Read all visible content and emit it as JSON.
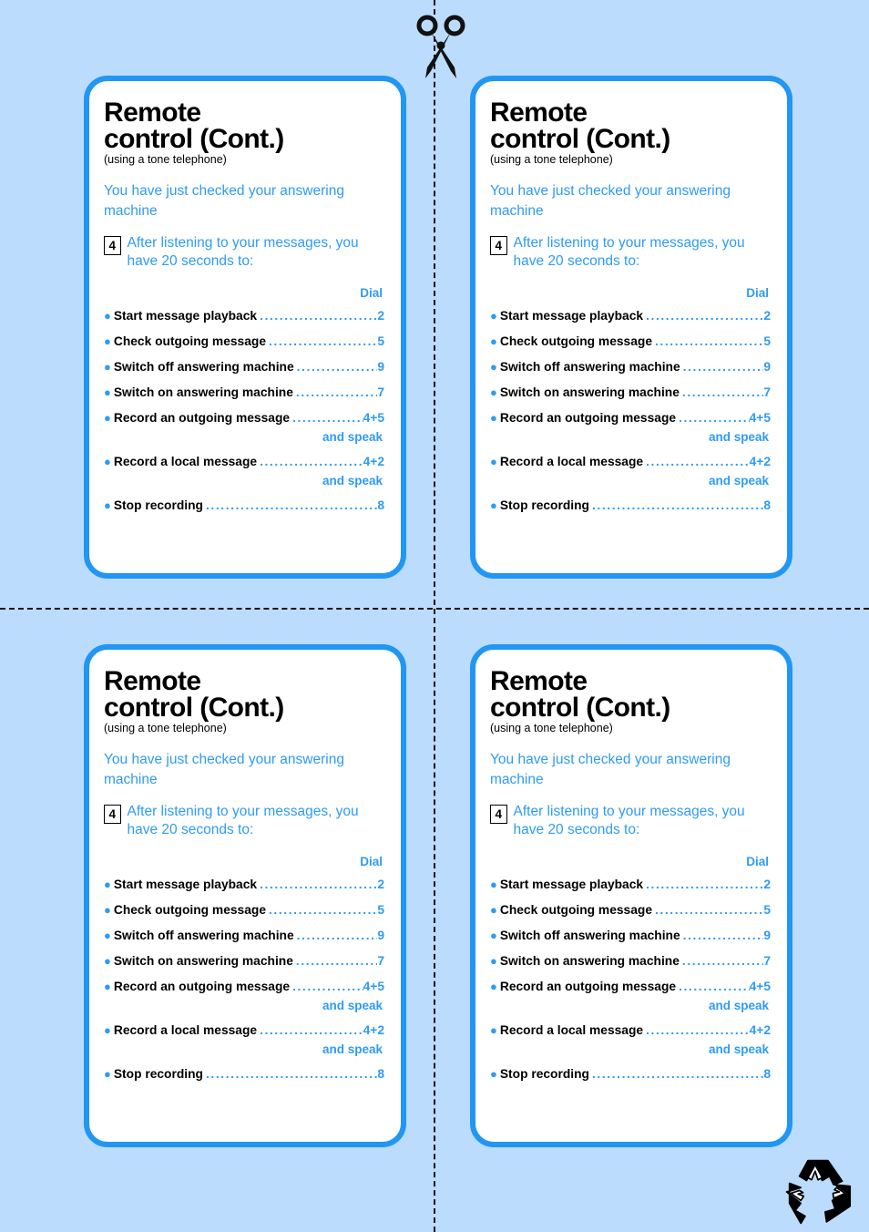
{
  "page": {
    "background_color": "#bbdcfd",
    "accent_blue": "#2e9bf5",
    "border_blue": "#2196f3",
    "scissors_icon": "scissors-icon",
    "recycle_icon": "recycle-icon",
    "cut_line_vertical": "vertical-dashed-cut-line",
    "cut_line_horizontal": "horizontal-dashed-cut-line"
  },
  "card": {
    "title_line1": "Remote",
    "title_line2": "control (Cont.)",
    "subtitle": "(using a tone telephone)",
    "intro": "You have just checked your answering machine",
    "step_number": "4",
    "step_text": "After listening to your messages, you have 20 seconds to:",
    "dial_header": "Dial",
    "options": [
      {
        "label": "Start message playback",
        "code": "2",
        "note": ""
      },
      {
        "label": "Check outgoing message",
        "code": "5",
        "note": ""
      },
      {
        "label": "Switch off answering machine",
        "code": "9",
        "note": ""
      },
      {
        "label": "Switch on answering machine",
        "code": "7",
        "note": ""
      },
      {
        "label": "Record an outgoing message",
        "code": "4+5",
        "note": "and speak"
      },
      {
        "label": "Record a local message",
        "code": "4+2",
        "note": "and speak"
      },
      {
        "label": "Stop recording",
        "code": "8",
        "note": ""
      }
    ]
  },
  "cards": [
    {
      "position": "top-left"
    },
    {
      "position": "top-right"
    },
    {
      "position": "bottom-left"
    },
    {
      "position": "bottom-right"
    }
  ]
}
